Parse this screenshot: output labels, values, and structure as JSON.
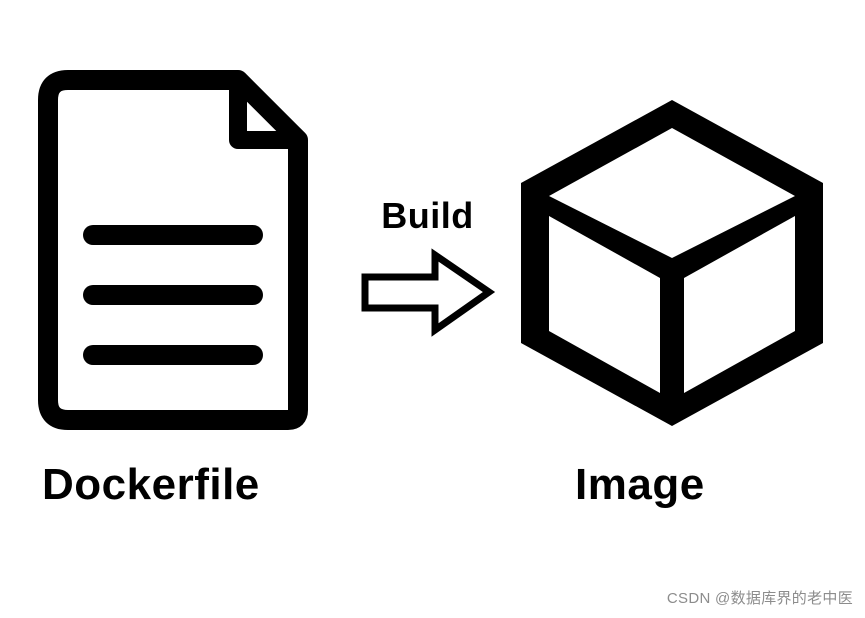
{
  "diagram": {
    "left_label": "Dockerfile",
    "arrow_label": "Build",
    "right_label": "Image"
  },
  "icons": {
    "file": "document-lines-icon",
    "arrow": "arrow-right-icon",
    "cube": "cube-3d-icon"
  },
  "watermark": "CSDN @数据库界的老中医",
  "colors": {
    "stroke": "#000000",
    "background": "#ffffff"
  }
}
